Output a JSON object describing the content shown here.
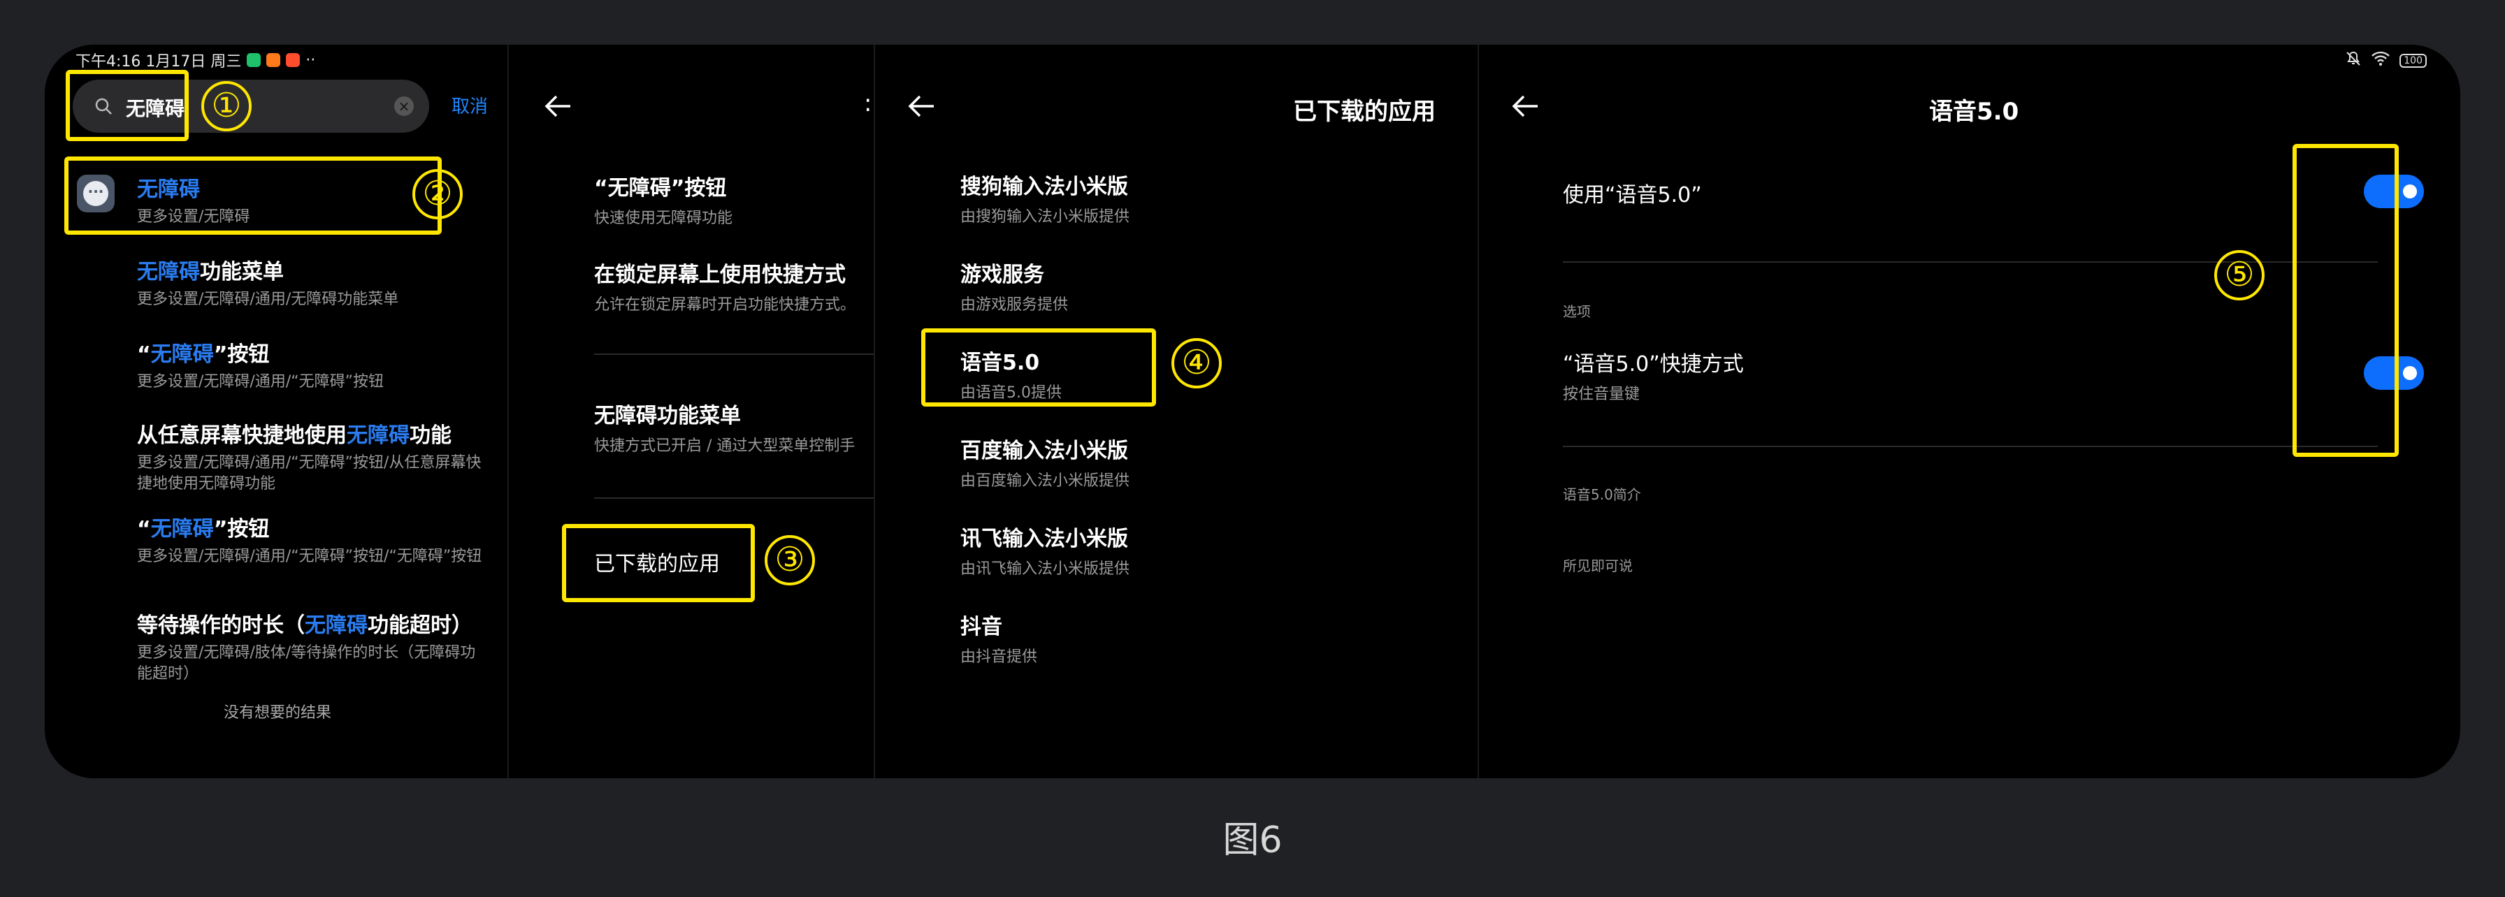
{
  "status_bar": {
    "time_date": "下午4:16 1月17日 周三",
    "more": "··",
    "battery": "100"
  },
  "search_pane": {
    "query": "无障碍",
    "cancel": "取消",
    "results": [
      {
        "pre": "",
        "hl": "无障碍",
        "post": "",
        "sub": "更多设置/无障碍"
      },
      {
        "pre": "",
        "hl": "无障碍",
        "post": "功能菜单",
        "sub": "更多设置/无障碍/通用/无障碍功能菜单"
      },
      {
        "pre": "“",
        "hl": "无障碍",
        "post": "”按钮",
        "sub": "更多设置/无障碍/通用/“无障碍”按钮"
      },
      {
        "pre": "从任意屏幕快捷地使用",
        "hl": "无障碍",
        "post": "功能",
        "sub": "更多设置/无障碍/通用/“无障碍”按钮/从任意屏幕快捷地使用无障碍功能"
      },
      {
        "pre": "“",
        "hl": "无障碍",
        "post": "”按钮",
        "sub": "更多设置/无障碍/通用/“无障碍”按钮/“无障碍”按钮"
      },
      {
        "pre": "等待操作的时长（",
        "hl": "无障碍",
        "post": "功能超时）",
        "sub": "更多设置/无障碍/肢体/等待操作的时长（无障碍功能超时）"
      }
    ],
    "no_more": "没有想要的结果"
  },
  "accessibility_pane": {
    "more": ":",
    "items": [
      {
        "title": "“无障碍”按钮",
        "sub": "快速使用无障碍功能"
      },
      {
        "title": "在锁定屏幕上使用快捷方式",
        "sub": "允许在锁定屏幕时开启功能快捷方式。"
      },
      {
        "title": "无障碍功能菜单",
        "sub": "快捷方式已开启 / 通过大型菜单控制手"
      },
      {
        "title": "已下载的应用",
        "sub": ""
      }
    ]
  },
  "downloaded_pane": {
    "title": "已下载的应用",
    "items": [
      {
        "title": "搜狗输入法小米版",
        "sub": "由搜狗输入法小米版提供"
      },
      {
        "title": "游戏服务",
        "sub": "由游戏服务提供"
      },
      {
        "title": "语音5.0",
        "sub": "由语音5.0提供"
      },
      {
        "title": "百度输入法小米版",
        "sub": "由百度输入法小米版提供"
      },
      {
        "title": "讯飞输入法小米版",
        "sub": "由讯飞输入法小米版提供"
      },
      {
        "title": "抖音",
        "sub": "由抖音提供"
      }
    ]
  },
  "voice_pane": {
    "title": "语音5.0",
    "use_label": "使用“语音5.0”",
    "use_on": true,
    "options_label": "选项",
    "shortcut_label": "“语音5.0”快捷方式",
    "shortcut_sub": "按住音量键",
    "shortcut_on": true,
    "intro": "语音5.0简介",
    "intro_text": "所见即可说"
  },
  "annotations": [
    "①",
    "②",
    "③",
    "④",
    "⑤"
  ],
  "caption": "图6",
  "colors": {
    "highlight": "#ffe700",
    "accent": "#0d6efd",
    "link": "#1e86ff"
  }
}
